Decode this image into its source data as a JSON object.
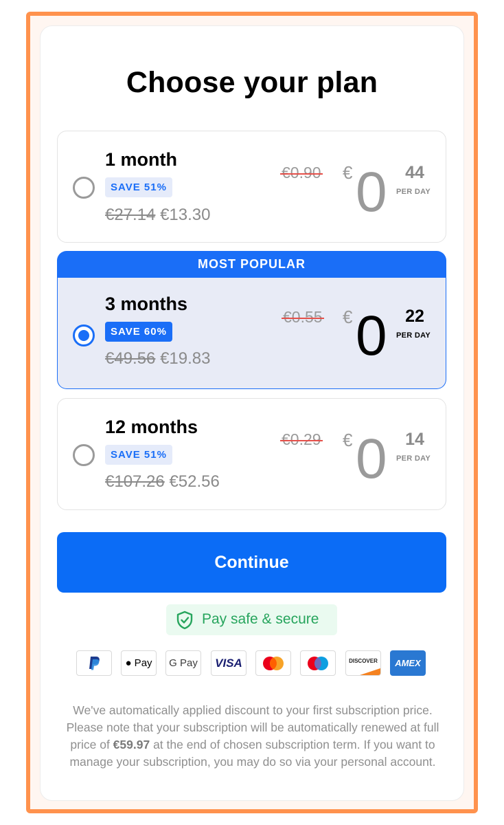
{
  "title": "Choose your plan",
  "plans": [
    {
      "name": "1 month",
      "save_badge": "SAVE 51%",
      "old_total": "€27.14",
      "new_total": "€13.30",
      "old_daily": "€0.90",
      "currency": "€",
      "daily_whole": "0",
      "daily_cents": "44",
      "per_day": "PER DAY",
      "selected": false
    },
    {
      "banner": "MOST POPULAR",
      "name": "3 months",
      "save_badge": "SAVE 60%",
      "old_total": "€49.56",
      "new_total": "€19.83",
      "old_daily": "€0.55",
      "currency": "€",
      "daily_whole": "0",
      "daily_cents": "22",
      "per_day": "PER DAY",
      "selected": true
    },
    {
      "name": "12 months",
      "save_badge": "SAVE 51%",
      "old_total": "€107.26",
      "new_total": "€52.56",
      "old_daily": "€0.29",
      "currency": "€",
      "daily_whole": "0",
      "daily_cents": "14",
      "per_day": "PER DAY",
      "selected": false
    }
  ],
  "continue_label": "Continue",
  "secure_label": "Pay safe & secure",
  "payment_methods": [
    {
      "name": "paypal-icon",
      "text": "P"
    },
    {
      "name": "apple-pay-icon",
      "text": " Pay"
    },
    {
      "name": "google-pay-icon",
      "text": "G Pay"
    },
    {
      "name": "visa-icon",
      "text": "VISA"
    },
    {
      "name": "mastercard-icon",
      "text": ""
    },
    {
      "name": "maestro-icon",
      "text": ""
    },
    {
      "name": "discover-icon",
      "text": "DISCOVER"
    },
    {
      "name": "amex-icon",
      "text": "AMEX"
    }
  ],
  "legal": {
    "before": "We've automatically applied discount to your first subscription price. Please note that your subscription will be automatically renewed at full price of ",
    "price": "€59.97",
    "after": " at the end of chosen subscription term. If you want to manage your subscription, you may do so via your personal account."
  },
  "colors": {
    "accent": "#1a6ef7",
    "frame": "#ff924d",
    "secure_green": "#27a55d",
    "strike_red": "#e5504a"
  }
}
